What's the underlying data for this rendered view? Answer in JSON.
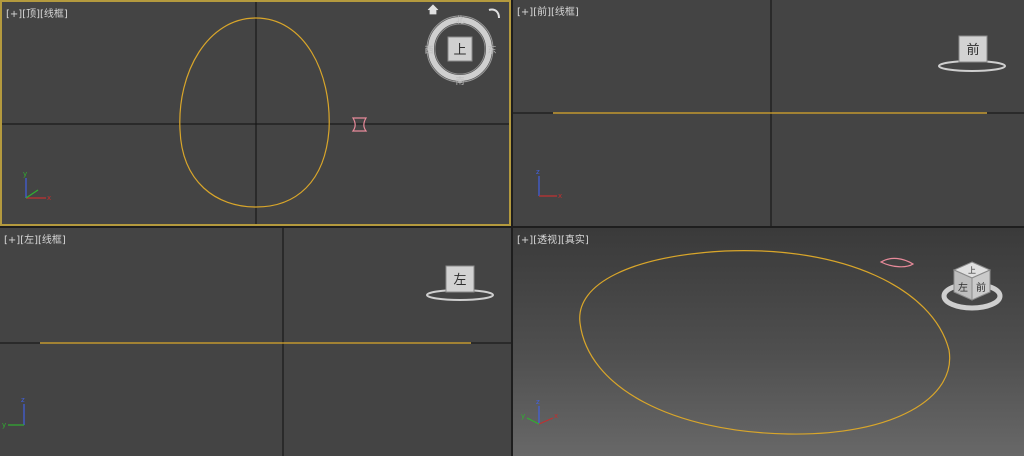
{
  "viewports": {
    "top": {
      "plus": "[+]",
      "view": "[顶]",
      "mode": "[线框]"
    },
    "front": {
      "plus": "[+]",
      "view": "[前]",
      "mode": "[线框]"
    },
    "left": {
      "plus": "[+]",
      "view": "[左]",
      "mode": "[线框]"
    },
    "persp": {
      "plus": "[+]",
      "view": "[透视]",
      "mode": "[真实]"
    }
  },
  "viewcube": {
    "top": {
      "face": "上",
      "north": "北",
      "south": "南",
      "east": "东",
      "west": "西"
    },
    "front": {
      "face": "前"
    },
    "left": {
      "face": "左"
    },
    "persp": {
      "face_top": "上",
      "face_left": "左",
      "face_right": "前"
    }
  },
  "axis": {
    "x": "x",
    "y": "y",
    "z": "z"
  },
  "colors": {
    "active_border": "#b49a3e",
    "spline": "#d9a62a",
    "gizmo_pink": "#e88a9a",
    "axis_x": "#c03030",
    "axis_y": "#30b030",
    "axis_z": "#4060e0"
  }
}
